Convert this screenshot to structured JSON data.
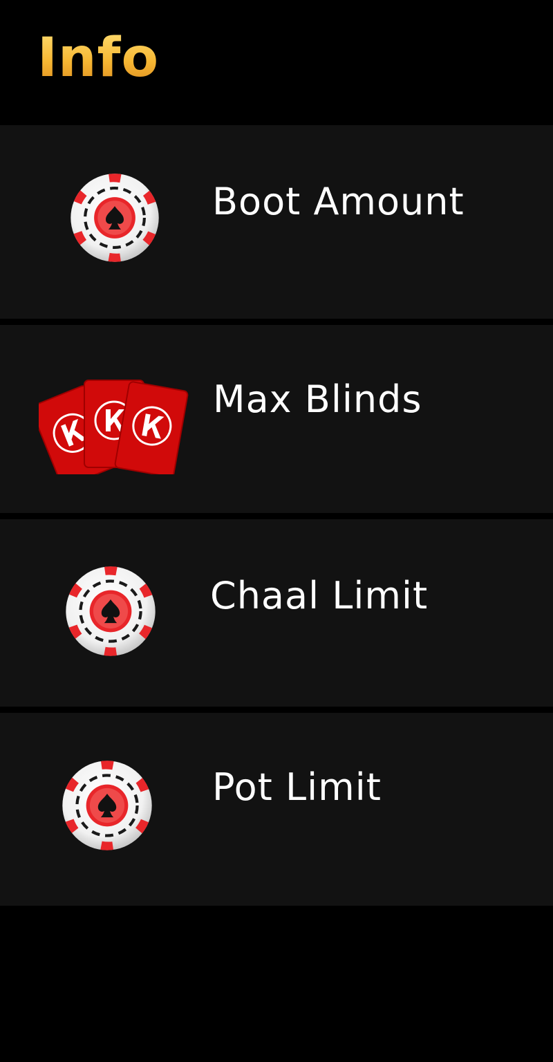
{
  "header": {
    "title": "Info",
    "title_gradient": [
      "#ffe27a",
      "#f7b733",
      "#d9861c"
    ]
  },
  "items": [
    {
      "label": "Boot Amount",
      "icon": "poker-chip-icon"
    },
    {
      "label": "Max Blinds",
      "icon": "playing-cards-icon"
    },
    {
      "label": "Chaal Limit",
      "icon": "poker-chip-icon"
    },
    {
      "label": "Pot Limit",
      "icon": "poker-chip-icon"
    }
  ],
  "colors": {
    "background": "#000000",
    "row_background": "#121212",
    "text": "#ffffff",
    "chip_red": "#e8262a",
    "card_red": "#d10a0a"
  }
}
